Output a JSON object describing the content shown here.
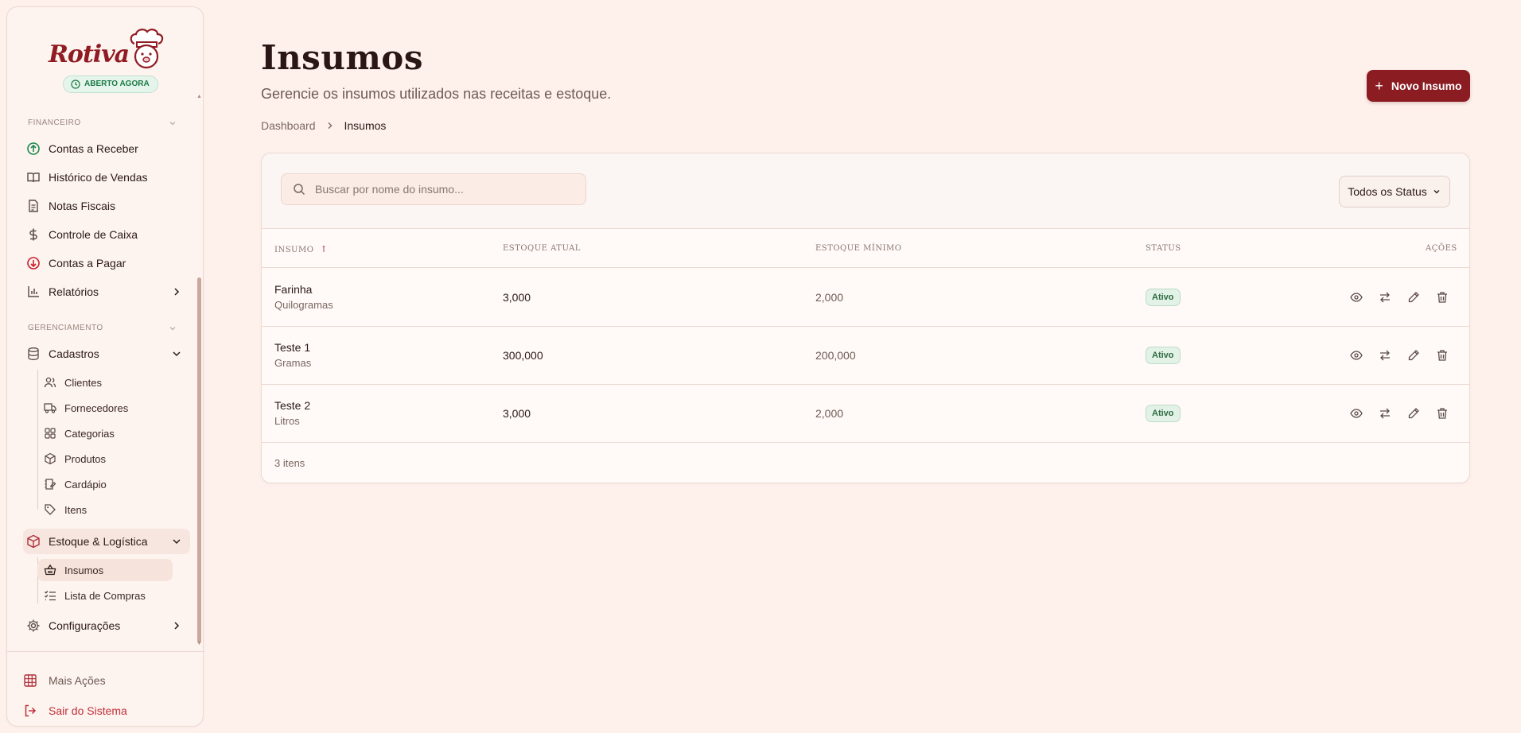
{
  "app": {
    "name": "Rotiva",
    "open_status": "ABERTO AGORA",
    "colors": {
      "primary": "#8a1c22",
      "background": "#fef1ec",
      "success": "#1b7a45"
    }
  },
  "sidebar": {
    "sections": {
      "financeiro": "FINANCEIRO",
      "gerenciamento": "GERENCIAMENTO"
    },
    "financeiro_items": [
      {
        "label": "Contas a Receber",
        "icon": "arrow-up-circle-icon"
      },
      {
        "label": "Histórico de Vendas",
        "icon": "book-open-icon"
      },
      {
        "label": "Notas Fiscais",
        "icon": "file-text-icon"
      },
      {
        "label": "Controle de Caixa",
        "icon": "dollar-sign-icon"
      },
      {
        "label": "Contas a Pagar",
        "icon": "arrow-down-circle-icon"
      },
      {
        "label": "Relatórios",
        "icon": "bar-chart-icon"
      }
    ],
    "cadastros": {
      "label": "Cadastros",
      "items": [
        "Clientes",
        "Fornecedores",
        "Categorias",
        "Produtos",
        "Cardápio",
        "Itens"
      ]
    },
    "estoque": {
      "label": "Estoque & Logística",
      "items": [
        "Insumos",
        "Lista de Compras"
      ]
    },
    "configuracoes": "Configurações",
    "footer": {
      "more_actions": "Mais Ações",
      "logout": "Sair do Sistema"
    }
  },
  "header": {
    "title": "Insumos",
    "subtitle": "Gerencie os insumos utilizados nas receitas e estoque.",
    "breadcrumb": [
      "Dashboard",
      "Insumos"
    ],
    "new_button": "Novo Insumo"
  },
  "filters": {
    "search_placeholder": "Buscar por nome do insumo...",
    "search_value": "",
    "status_selected": "Todos os Status"
  },
  "table": {
    "columns": {
      "insumo": "Insumo",
      "estoque_atual": "Estoque Atual",
      "estoque_minimo": "Estoque Mínimo",
      "status": "Status",
      "acoes": "Ações"
    },
    "sort_indicator": "↑",
    "rows": [
      {
        "name": "Farinha",
        "unit": "Quilogramas",
        "estoque_atual": "3,000",
        "estoque_minimo": "2,000",
        "status": "Ativo"
      },
      {
        "name": "Teste 1",
        "unit": "Gramas",
        "estoque_atual": "300,000",
        "estoque_minimo": "200,000",
        "status": "Ativo"
      },
      {
        "name": "Teste 2",
        "unit": "Litros",
        "estoque_atual": "3,000",
        "estoque_minimo": "2,000",
        "status": "Ativo"
      }
    ],
    "footer_count": "3 itens"
  }
}
